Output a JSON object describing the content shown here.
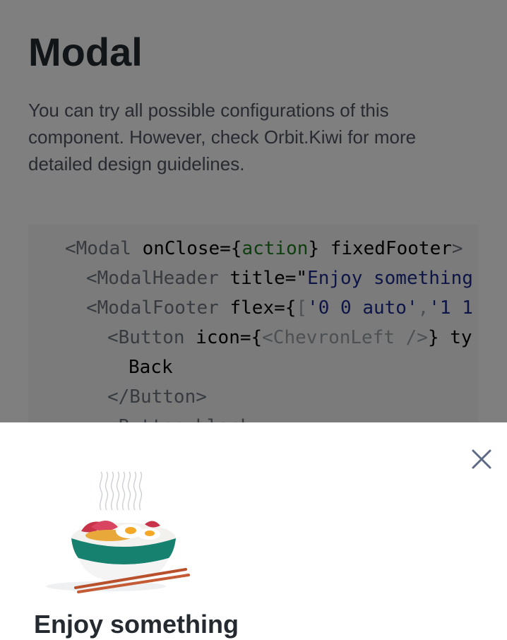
{
  "page": {
    "title": "Modal",
    "description": "You can try all possible configurations of this component. However, check Orbit.Kiwi for more detailed design guidelines."
  },
  "code": {
    "l1_open": "<Modal ",
    "l1_attr": "onClose={",
    "l1_action": "action",
    "l1_rest": "} fixedFooter",
    "l1_close": ">",
    "l2_tag": "<ModalHeader ",
    "l2_attr": "title=\"",
    "l2_str": "Enjoy something",
    "l3_tag": "<ModalFooter ",
    "l3_attr": "flex={",
    "l3_bracket": "[",
    "l3_str1": "'0 0 auto'",
    "l3_comma": ",",
    "l3_str2": "'1 1",
    "l4_tag": "<Button ",
    "l4_attr": "icon={",
    "l4_cmp": "<ChevronLeft />",
    "l4_rest": "} ty",
    "l5": "Back",
    "l6": "</Button>",
    "l7": "<Button block"
  },
  "modal": {
    "close_icon": "close-icon",
    "illustration": "noodle-bowl-illustration",
    "title": "Enjoy something"
  },
  "colors": {
    "overlay": "rgba(0,0,0,0.5)",
    "string": "#1b2a8f",
    "action": "#1c7a1c",
    "close_icon": "#5d6a85"
  }
}
